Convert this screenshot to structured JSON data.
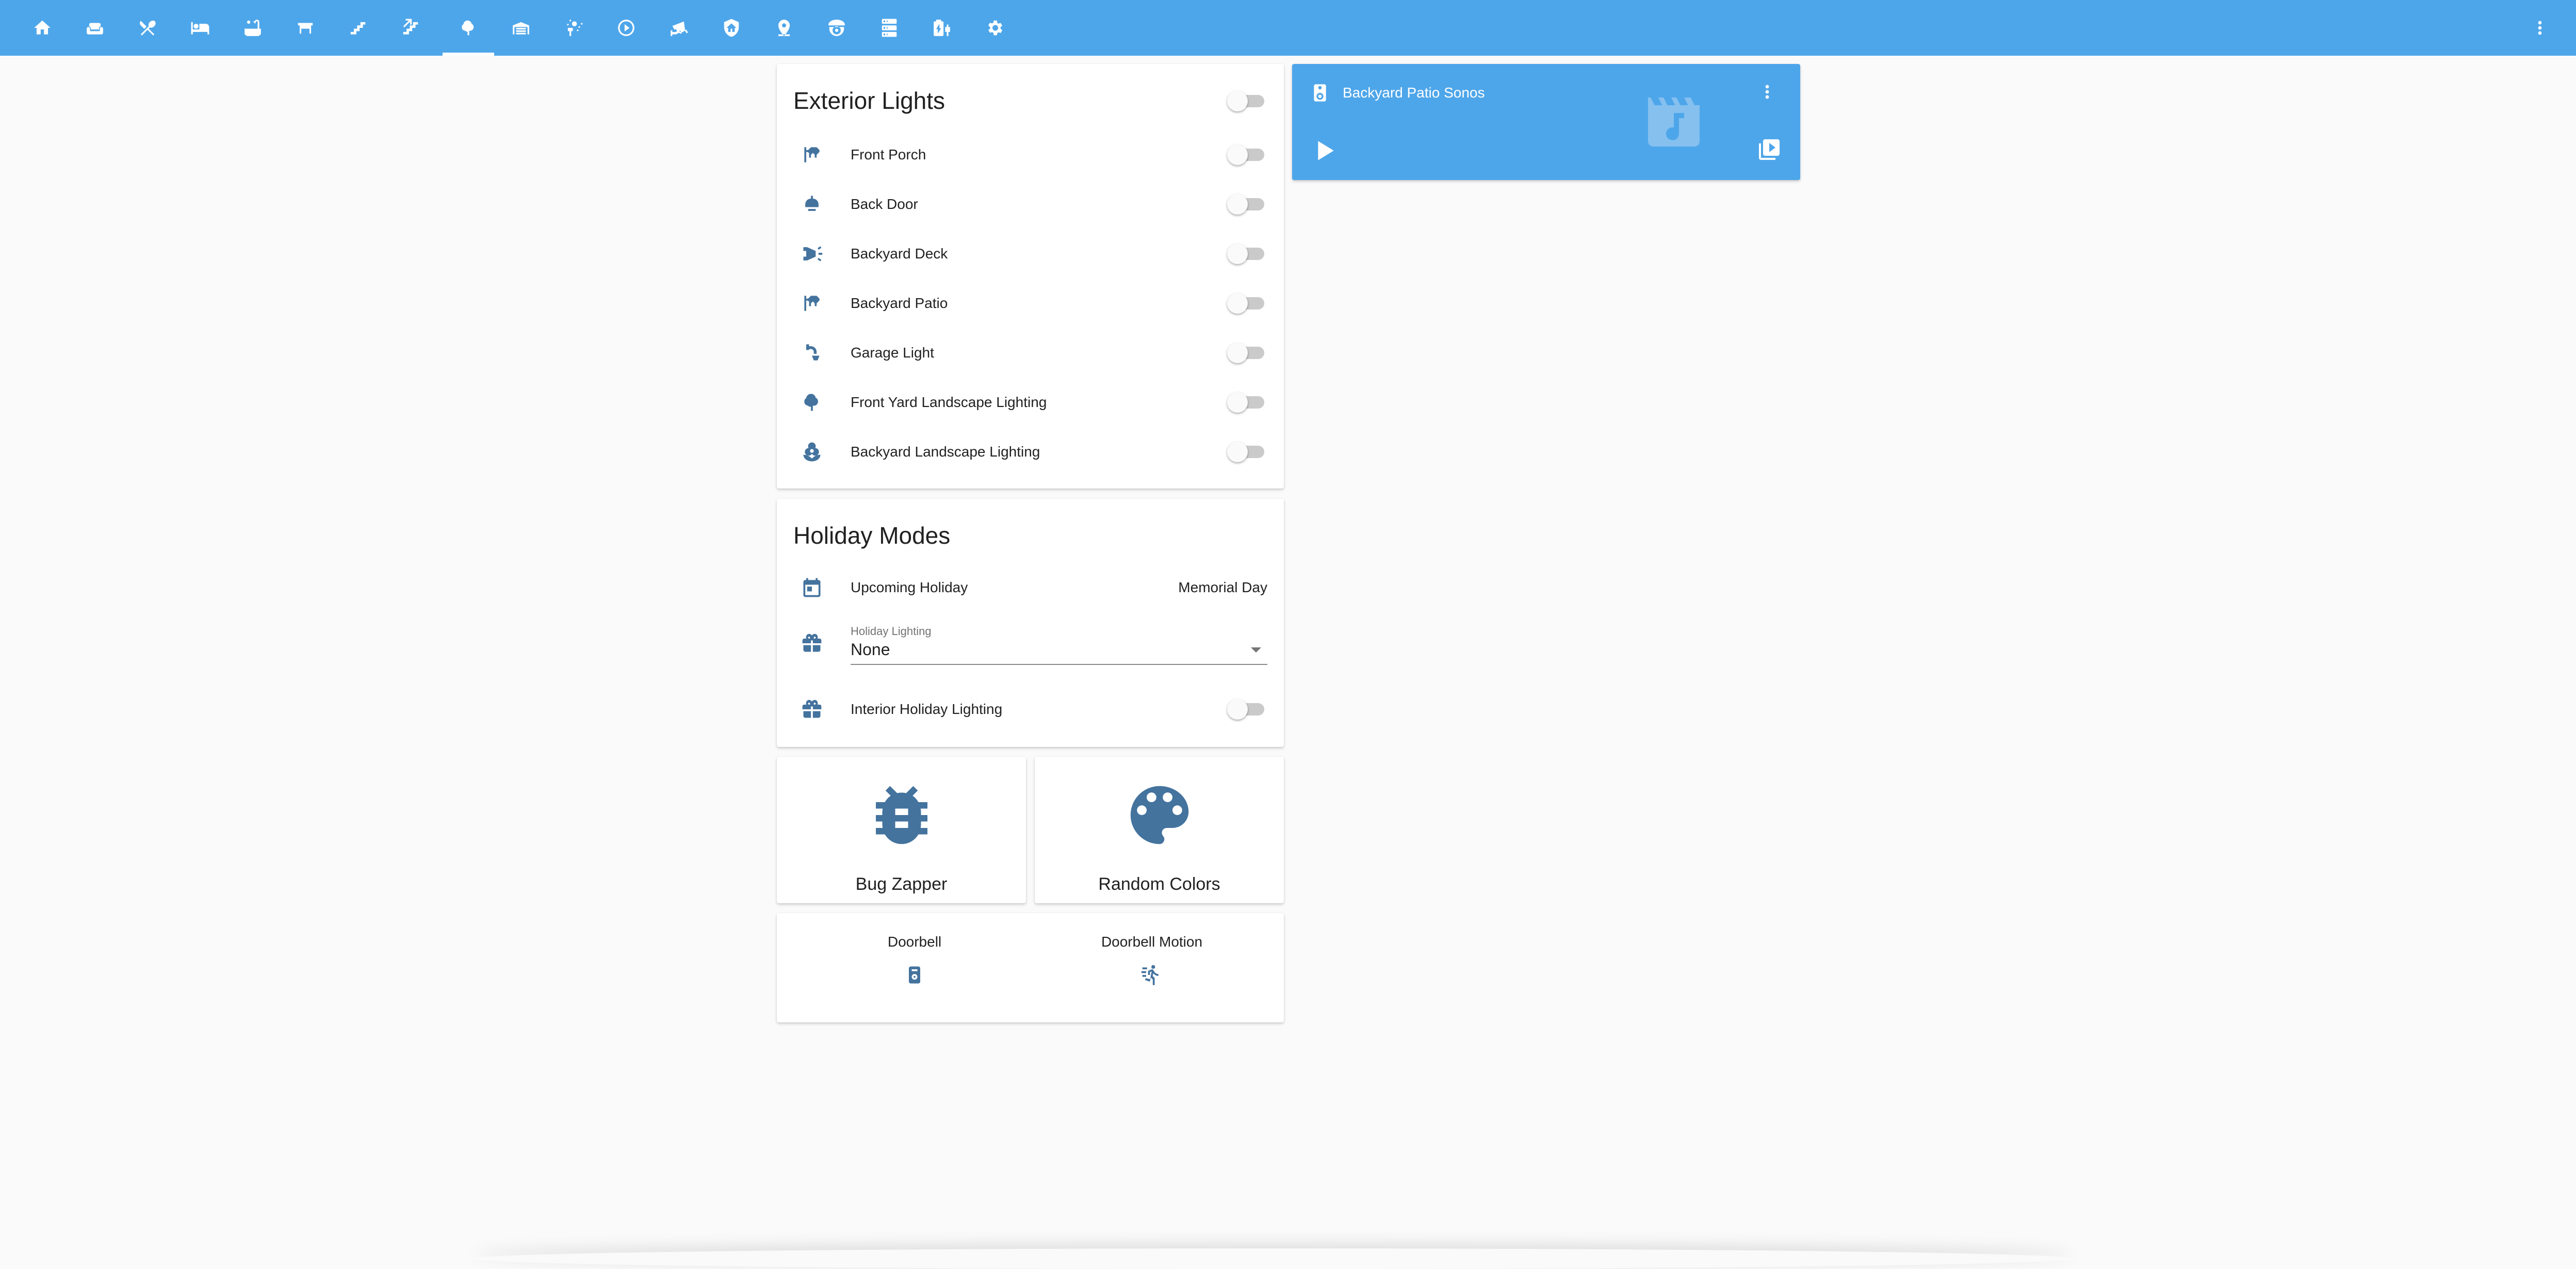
{
  "toolbar": {
    "tabs": [
      {
        "icon": "home-icon"
      },
      {
        "icon": "sofa-icon"
      },
      {
        "icon": "silverware-icon"
      },
      {
        "icon": "bed-icon"
      },
      {
        "icon": "bathtub-icon"
      },
      {
        "icon": "desk-icon"
      },
      {
        "icon": "stairs-icon"
      },
      {
        "icon": "stairs-up-icon"
      },
      {
        "icon": "tree-icon",
        "active": true
      },
      {
        "icon": "garage-icon"
      },
      {
        "icon": "sprinkler-icon"
      },
      {
        "icon": "play-circle-icon"
      },
      {
        "icon": "cctv-icon"
      },
      {
        "icon": "shield-home-icon"
      },
      {
        "icon": "map-marker-icon"
      },
      {
        "icon": "robot-vacuum-icon"
      },
      {
        "icon": "server-icon"
      },
      {
        "icon": "battery-charging-icon"
      },
      {
        "icon": "gear-icon"
      }
    ],
    "colors": {
      "background": "#4ea6ea",
      "icon": "#ffffff"
    }
  },
  "exterior_lights": {
    "title": "Exterior Lights",
    "master_on": false,
    "rows": [
      {
        "label": "Front Porch",
        "icon": "outdoor-lamp-icon",
        "on": false
      },
      {
        "label": "Back Door",
        "icon": "ceiling-light-icon",
        "on": false
      },
      {
        "label": "Backyard Deck",
        "icon": "spotlight-icon",
        "on": false
      },
      {
        "label": "Backyard Patio",
        "icon": "outdoor-lamp-icon",
        "on": false
      },
      {
        "label": "Garage Light",
        "icon": "wall-lamp-icon",
        "on": false
      },
      {
        "label": "Front Yard Landscape Lighting",
        "icon": "tree-icon",
        "on": false
      },
      {
        "label": "Backyard Landscape Lighting",
        "icon": "flower-icon",
        "on": false
      }
    ]
  },
  "holiday_modes": {
    "title": "Holiday Modes",
    "upcoming": {
      "label": "Upcoming Holiday",
      "value": "Memorial Day",
      "icon": "calendar-icon"
    },
    "holiday_lighting": {
      "label": "Holiday Lighting",
      "value": "None",
      "icon": "gift-icon"
    },
    "interior": {
      "label": "Interior Holiday Lighting",
      "icon": "gift-icon",
      "on": false
    }
  },
  "media_player": {
    "title": "Backyard Patio Sonos",
    "icon": "speaker-icon",
    "art_icon": "music-video-icon",
    "color": "#4ea6ea"
  },
  "buttons": [
    {
      "name": "Bug Zapper",
      "icon": "bug-icon"
    },
    {
      "name": "Random Colors",
      "icon": "palette-icon"
    }
  ],
  "glance": [
    {
      "name": "Doorbell",
      "icon": "doorbell-icon"
    },
    {
      "name": "Doorbell Motion",
      "icon": "motion-icon"
    }
  ],
  "accent_icon_color": "#44739e"
}
